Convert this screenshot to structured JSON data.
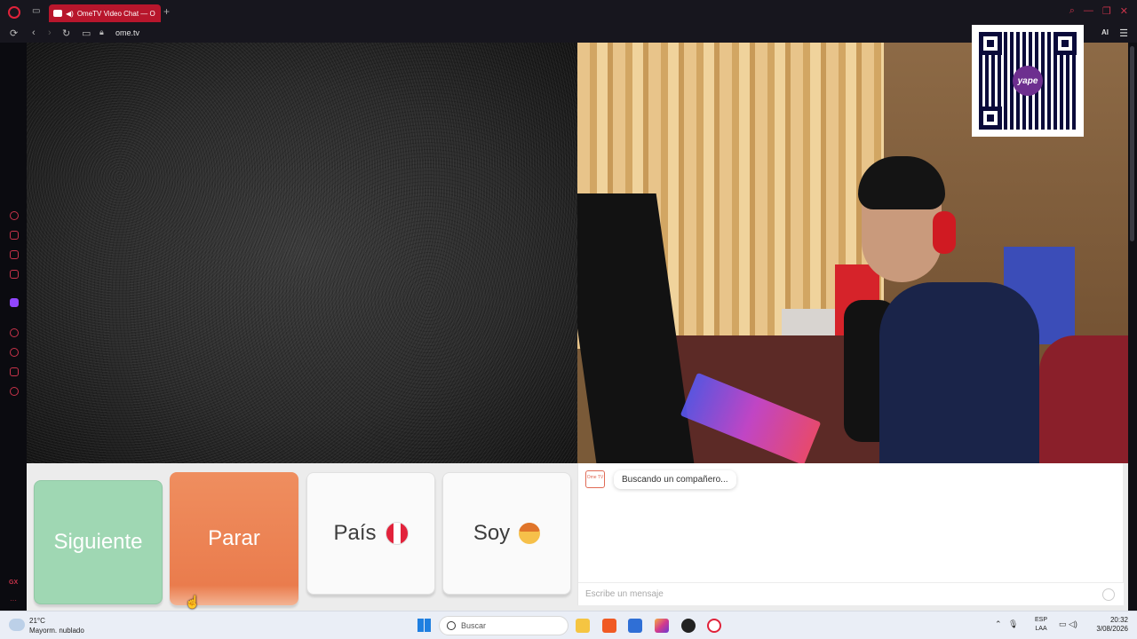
{
  "browser": {
    "tab_title": "OmeTV Video Chat — O",
    "new_tab_symbol": "+",
    "url": "ome.tv",
    "ai_label": "AI",
    "sidebar_gx_label": "GX"
  },
  "video": {
    "remote_state": "static-noise",
    "qr_logo_text": "yape"
  },
  "controls": {
    "next_label": "Siguiente",
    "stop_label": "Parar",
    "country_label": "País",
    "country_flag": "peru-flag-icon",
    "gender_label": "Soy",
    "gender_icon": "boy-face-icon"
  },
  "chat": {
    "logo_text": "Ome TV",
    "status_message": "Buscando un compañero...",
    "input_placeholder": "Escribe un mensaje"
  },
  "taskbar": {
    "temperature": "21°C",
    "weather_desc": "Mayorm. nublado",
    "search_placeholder": "Buscar",
    "lang_top": "ESP",
    "lang_bottom": "LAA",
    "time": "20:32",
    "date": "3/08/2026"
  },
  "colors": {
    "next_button": "#9fd7b3",
    "stop_button": "#ea7c4d",
    "browser_accent": "#b8162c"
  }
}
